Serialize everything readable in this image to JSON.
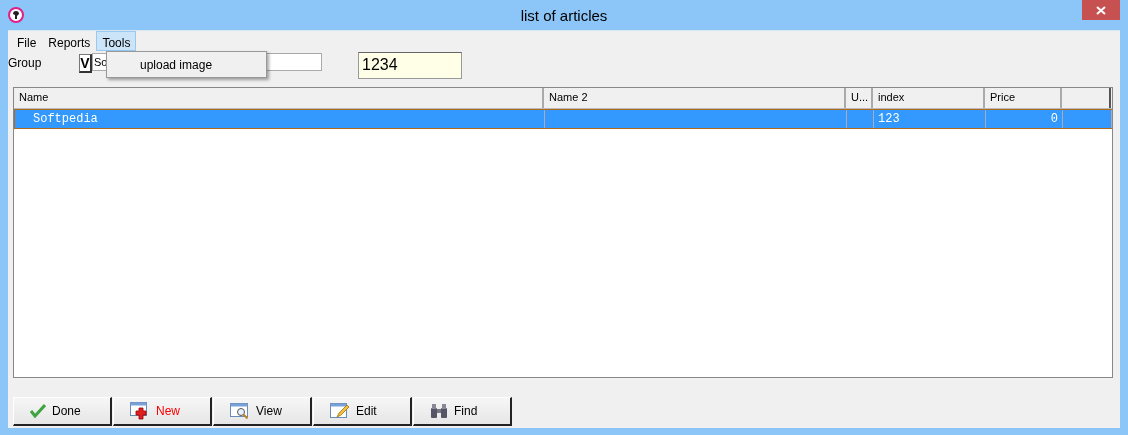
{
  "window": {
    "title": "list of articles"
  },
  "menu": [
    {
      "label": "File",
      "selected": false
    },
    {
      "label": "Reports",
      "selected": false
    },
    {
      "label": "Tools",
      "selected": true
    }
  ],
  "open_menu": {
    "items": [
      "upload image"
    ]
  },
  "filter": {
    "label": "Group",
    "toggle": "V",
    "group_value": "So",
    "code_value": "1234"
  },
  "table": {
    "columns": [
      "Name",
      "Name 2",
      "U...",
      "index",
      "Price"
    ],
    "rows": [
      {
        "name": "Softpedia",
        "index": "123",
        "price": "0",
        "selected": true
      }
    ]
  },
  "buttons": [
    {
      "label": "Done",
      "kind": "done"
    },
    {
      "label": "New",
      "kind": "new"
    },
    {
      "label": "View",
      "kind": "view"
    },
    {
      "label": "Edit",
      "kind": "edit"
    },
    {
      "label": "Find",
      "kind": "find"
    }
  ]
}
